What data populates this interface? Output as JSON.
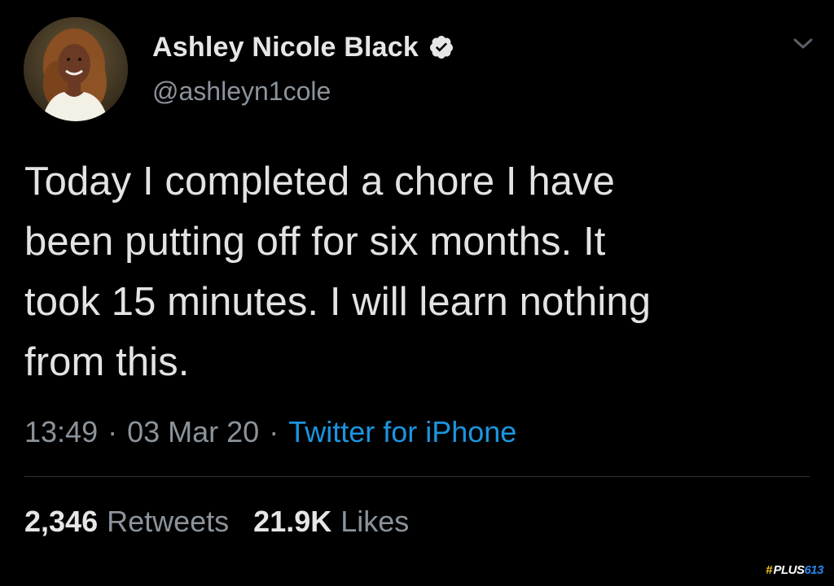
{
  "tweet": {
    "author": {
      "display_name": "Ashley Nicole Black",
      "handle": "@ashleyn1cole",
      "verified": true,
      "avatar_icon": "profile-photo"
    },
    "text": "Today I completed a chore I have\nbeen putting off for six months. It\ntook 15 minutes. I will learn nothing\nfrom this.",
    "time": "13:49",
    "date": "03 Mar 20",
    "separator": "·",
    "source": "Twitter for iPhone",
    "stats": {
      "retweets_count": "2,346",
      "retweets_label": "Retweets",
      "likes_count": "21.9K",
      "likes_label": "Likes"
    }
  },
  "icons": {
    "verified": "verified-badge-icon",
    "menu": "chevron-down-icon"
  },
  "watermark": {
    "hash": "#",
    "text": "PLUS",
    "number": "613"
  },
  "colors": {
    "background": "#000000",
    "primary_text": "#e3e3e3",
    "muted_text": "#8b939b",
    "link": "#1b95e0"
  }
}
